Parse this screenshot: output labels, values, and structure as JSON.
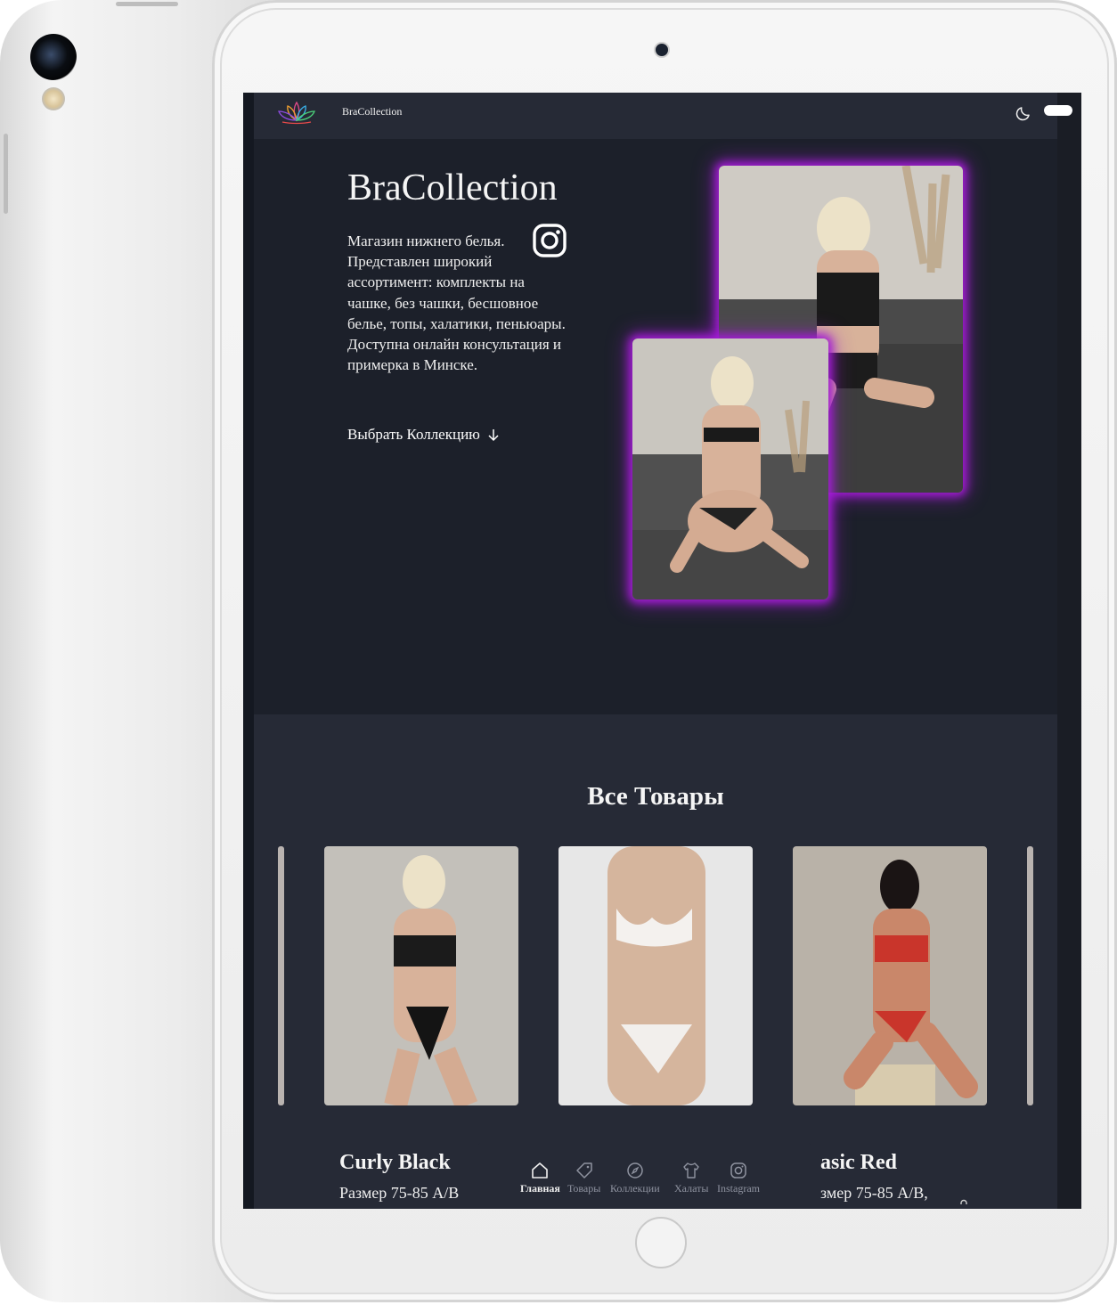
{
  "header": {
    "brand": "BraCollection"
  },
  "hero": {
    "title": "BraCollection",
    "description": "Магазин нижнего белья. Представлен широкий ассортимент: комплекты на чашке, без чашки, бесшовное белье, топы, халатики, пеньюары. Доступна онлайн консультация и примерка в Минске.",
    "cta_label": "Выбрать Коллекцию"
  },
  "products": {
    "section_title": "Все Товары",
    "items": [
      {
        "name": "Curly Black",
        "size": "Размер 75-85 A/B"
      },
      {
        "name": "",
        "size": ""
      },
      {
        "name": "asic Red",
        "size": "змер 75-85 A/B,"
      }
    ]
  },
  "bottom_nav": {
    "items": [
      {
        "label": "Главная",
        "icon": "home-icon",
        "active": true
      },
      {
        "label": "Товары",
        "icon": "tag-icon",
        "active": false
      },
      {
        "label": "Коллекции",
        "icon": "compass-icon",
        "active": false
      },
      {
        "label": "Халаты",
        "icon": "shirt-icon",
        "active": false
      },
      {
        "label": "Instagram",
        "icon": "instagram-icon",
        "active": false
      }
    ]
  },
  "colors": {
    "page_bg": "#1c202a",
    "panel_bg": "#262a36",
    "glow": "#a41bd6",
    "text": "#f5f5f5",
    "nav_inactive": "#8f93a0"
  }
}
